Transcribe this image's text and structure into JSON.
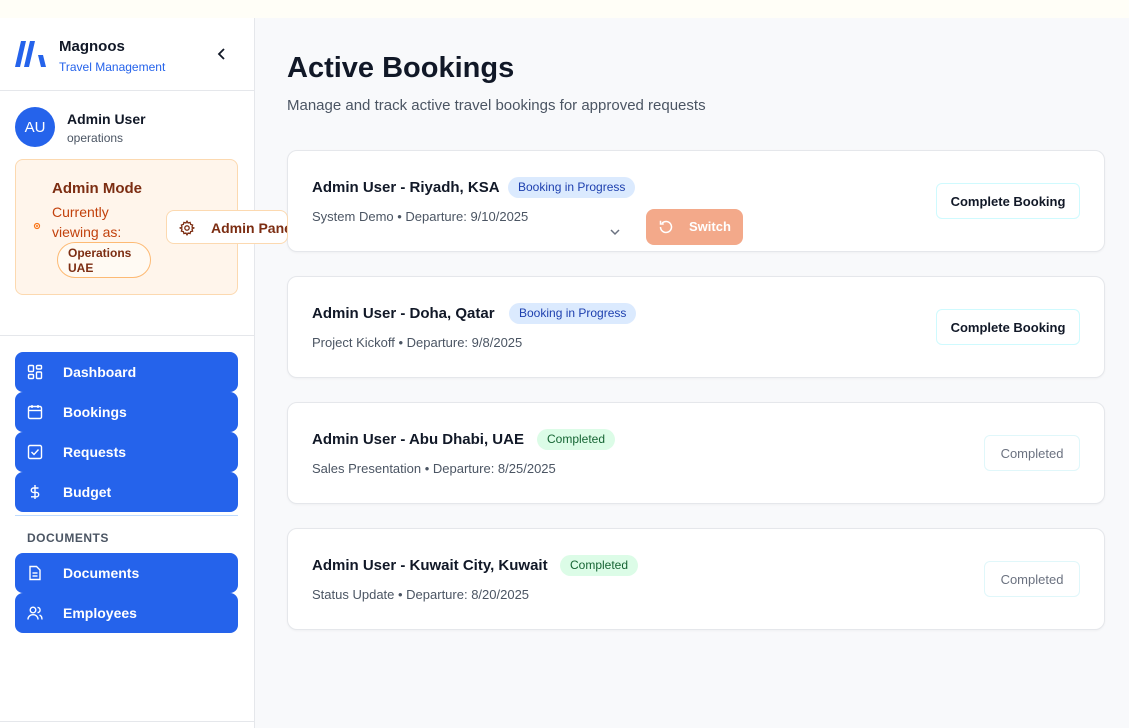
{
  "brand": {
    "name": "Magnoos",
    "subtitle": "Travel Management"
  },
  "user": {
    "initials": "AU",
    "name": "Admin User",
    "role": "operations"
  },
  "admin_mode": {
    "title": "Admin Mode",
    "viewing_label": "Currently viewing as:",
    "viewing_as": "Operations UAE",
    "panel_button": "Admin Panel"
  },
  "nav": {
    "items": [
      {
        "label": "Dashboard",
        "icon": "grid-icon"
      },
      {
        "label": "Bookings",
        "icon": "calendar-icon"
      },
      {
        "label": "Requests",
        "icon": "check-square-icon"
      },
      {
        "label": "Budget",
        "icon": "dollar-icon"
      }
    ],
    "section_label": "DOCUMENTS",
    "section_items": [
      {
        "label": "Documents",
        "icon": "file-text-icon"
      },
      {
        "label": "Employees",
        "icon": "users-icon"
      }
    ]
  },
  "page": {
    "title": "Active Bookings",
    "subtitle": "Manage and track active travel bookings for approved requests"
  },
  "bookings": [
    {
      "title": "Admin User - Riyadh, KSA",
      "status": "Booking in Progress",
      "meta": "System Demo • Departure: 9/10/2025",
      "action": "Complete Booking"
    },
    {
      "title": "Admin User - Doha, Qatar",
      "status": "Booking in Progress",
      "meta": "Project Kickoff • Departure: 9/8/2025",
      "action": "Complete Booking"
    },
    {
      "title": "Admin User - Abu Dhabi, UAE",
      "status": "Completed",
      "meta": "Sales Presentation • Departure: 8/25/2025",
      "action": "Completed"
    },
    {
      "title": "Admin User - Kuwait City, Kuwait",
      "status": "Completed",
      "meta": "Status Update • Departure: 8/20/2025",
      "action": "Completed"
    }
  ],
  "switch_button": "Switch",
  "colors": {
    "primary": "#2563eb",
    "admin_accent": "#c2410c",
    "switch": "#f3a98a",
    "progress_badge": "#dbeafe",
    "completed_badge": "#dcfce7"
  }
}
